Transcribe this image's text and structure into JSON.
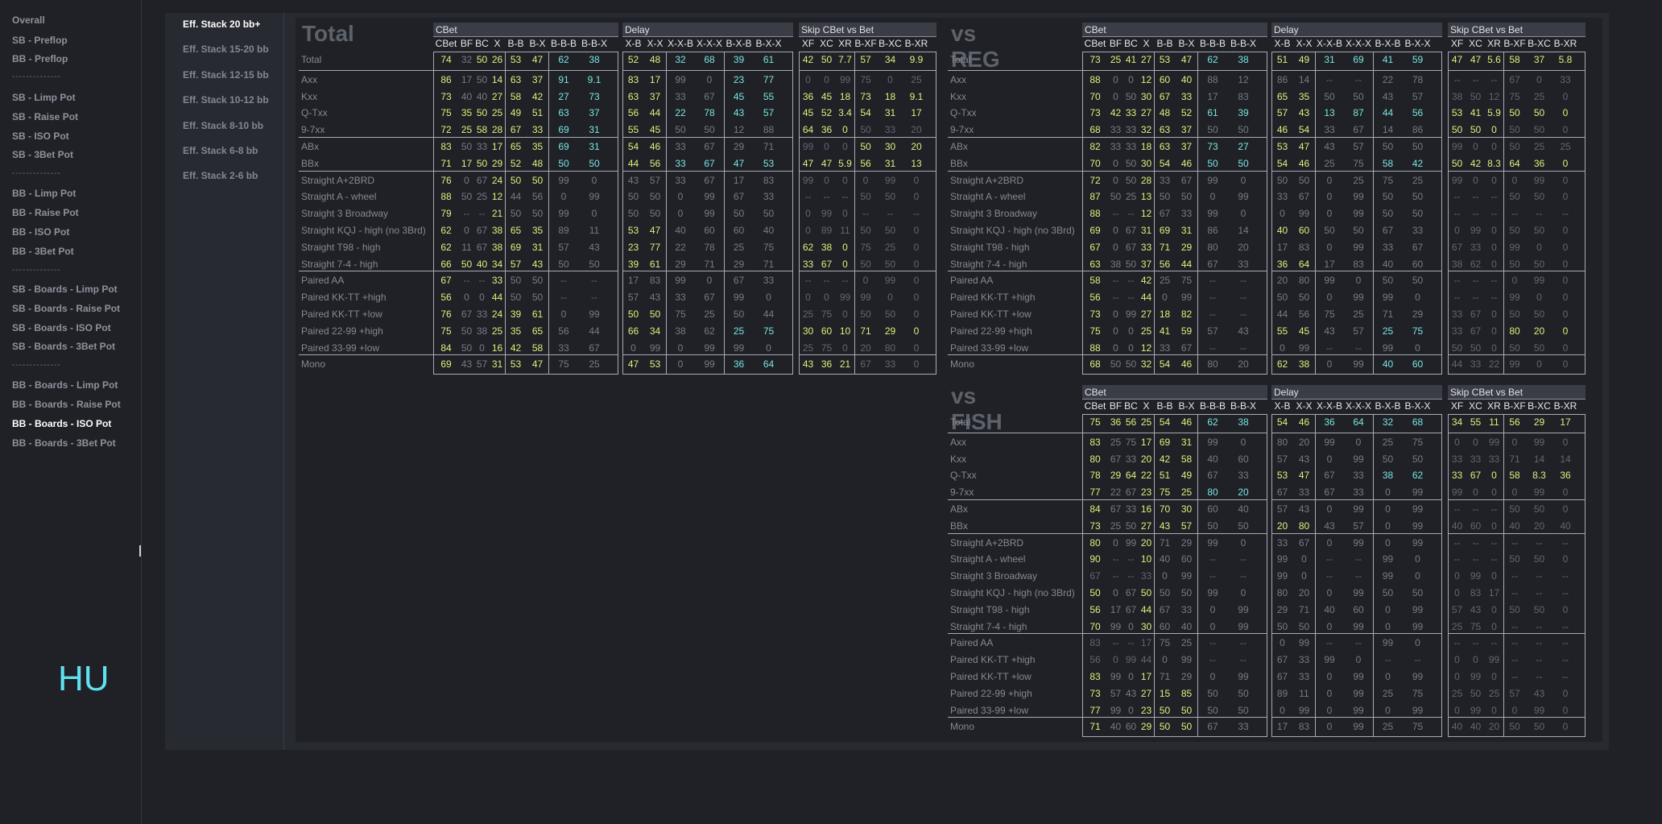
{
  "nav": {
    "items": [
      "Overall",
      "SB - Preflop",
      "BB - Preflop",
      "--------------",
      "SB - Limp Pot",
      "SB - Raise Pot",
      "SB - ISO Pot",
      "SB - 3Bet Pot",
      "--------------",
      "BB - Limp Pot",
      "BB - Raise Pot",
      "BB - ISO Pot",
      "BB - 3Bet Pot",
      "--------------",
      "SB - Boards - Limp Pot",
      "SB - Boards - Raise Pot",
      "SB - Boards - ISO Pot",
      "SB - Boards - 3Bet Pot",
      "--------------",
      "BB - Boards - Limp Pot",
      "BB - Boards - Raise Pot",
      "BB - Boards - ISO Pot",
      "BB - Boards - 3Bet Pot"
    ],
    "active": "BB - Boards - ISO Pot",
    "hu": "HU"
  },
  "stacks": {
    "items": [
      "Eff. Stack 20 bb+",
      "Eff. Stack 15-20 bb",
      "Eff. Stack 12-15 bb",
      "Eff. Stack 10-12 bb",
      "Eff. Stack 8-10 bb",
      "Eff. Stack 6-8 bb",
      "Eff. Stack 2-6 bb"
    ],
    "active": "Eff. Stack 20 bb+"
  },
  "groups": [
    "CBet",
    "Delay",
    "Skip CBet vs Bet"
  ],
  "subheaders": [
    [
      "CBet",
      "BF",
      "BC",
      "X",
      "B-B",
      "B-X",
      "B-B-B",
      "B-B-X"
    ],
    [
      "X-B",
      "X-X",
      "X-X-B",
      "X-X-X",
      "B-X-B",
      "B-X-X"
    ],
    [
      "XF",
      "XC",
      "XR",
      "B-XF",
      "B-XC",
      "B-XR"
    ]
  ],
  "row_labels": [
    "Total",
    "Axx",
    "Kxx",
    "Q-Txx",
    "9-7xx",
    "ABx",
    "BBx",
    "Straight A+2BRD",
    "Straight A - wheel",
    "Straight 3 Broadway",
    "Straight KQJ - high (no 3Brd)",
    "Straight T98 - high",
    "Straight 7-4 - high",
    "Paired AA",
    "Paired KK-TT +high",
    "Paired KK-TT +low",
    "Paired 22-99 +high",
    "Paired 33-99 +low",
    "Mono"
  ],
  "row_labels_fish": [
    "Total",
    "Axx",
    "Kxx",
    "Q-Txx",
    "9-7xx",
    "ABx",
    "BBx",
    "Straight A+2BRD",
    "Straight A - wheel",
    "Straight 3 Broadway",
    "Straight KQJ - high (no 3Brd)",
    "Straight T98 - high",
    "Straight 7-4 - high",
    "Paired AA",
    "Paired KK-TT +high",
    "Paired KK-TT +low",
    "Paired 22-99 +high",
    "Paired 33-99 +low",
    "Mono"
  ],
  "tables": {
    "total": {
      "title": "Total",
      "rows": [
        "74y 32g 50y 26y|53y 47y|62c 38c|52y 48y|32c 68c|39c 61c|42y 50y 7.7y|57y 34y 9.9y",
        "86y 17g 50g 14y|63y 37y|91c 9.1c|83y 17y|99g 0g|23c 77c|0e 0e 99e|75e 0e 25e",
        "73y 40g 40g 27y|58y 42y|27c 73c|63y 37y|33g 67g|45c 55c|36y 45y 18y|73y 18y 9.1y",
        "75y 35y 50y 25y|49y 51y|63c 37c|56y 44y|22c 78c|43c 57c|45y 52y 3.4y|54y 31y 17y",
        "72y 25y 58y 28y|67y 33y|69c 31c|55y 45y|50g 50g|12g 88g|64y 36y 0y|50e 33e 20e",
        "83y 50g 33g 17y|65y 35y|69c 31c|54y 46y|33g 67g|29g 71g|99e 0e 0e|50y 30y 20y",
        "71y 17y 50y 29y|52y 48y|50c 50c|44y 56y|33c 67c|47c 53c|47y 47y 5.9y|56y 31y 13y",
        "76y 0g 67g 24y|50y 50y|99g 0g|43g 57g|33g 67g|17g 83g|99e 0e 0e|0e 99e 0e",
        "88y 50g 25g 12y|44g 56g|0g 99g|50g 50g|0g 99g|67g 33g|--e --e --e|50e 50e 0e",
        "79y --e --e 21y|50g 50g|99g 0g|50g 50g|0g 99g|50g 50g|0e 99e 0e|--e --e --e",
        "62y 0g 67g 38y|65y 35y|89g 11g|53y 47y|40g 60g|60g 40g|0e 89e 11e|50e 50e 0e",
        "62y 11g 67g 38y|69y 31y|57g 43g|23y 77y|22g 78g|25g 75g|62y 38y 0y|75e 25e 0e",
        "66y 50y 40y 34y|57y 43y|50g 50g|39y 61y|29g 71g|29g 71g|33y 67y 0y|50e 50e 0e",
        "67y --e --e 33y|50g 50g|--e --e|17g 83g|99g 0g|67g 33g|--e --e --e|0e 99e 0e",
        "56y 0g 0g 44y|50g 50g|--e --e|57g 43g|33g 67g|99g 0g|0e 0e 99e|99e 0e 0e",
        "76y 67g 33g 24y|39y 61y|0g 99g|50y 50y|75g 25g|50g 44g|25e 75e 0e|50e 50e 0e",
        "75y 50g 38g 25y|35y 65y|56g 44g|66y 34y|38g 62g|25c 75c|30y 60y 10y|71y 29y 0y",
        "84y 50g 0g 16y|42y 58y|33g 67g|0g 99g|0g 99g|99g 0g|25e 75e 0e|20e 80e 0e",
        "69y 43g 57g 31y|53y 47y|75g 25g|47y 53y|0g 99g|36c 64c|43y 36y 21y|67e 33e 0e"
      ]
    },
    "reg": {
      "title": "vs REG",
      "rows": [
        "73y 25y 41y 27y|53y 47y|62c 38c|51y 49y|31c 69c|41c 59c|47y 47y 5.6y|58y 37y 5.8y",
        "88y 0g 0g 12y|60y 40y|88g 12g|86g 14g|--e --e|22g 78g|--e --e --e|67e 0e 33e",
        "70y 0g 50g 30y|67y 33y|17g 83g|65y 35y|50g 50g|43g 57g|38e 50e 12e|75e 25e 0e",
        "73y 42y 33y 27y|48y 52y|61c 39c|57y 43y|13c 87c|44c 56c|53y 41y 5.9y|50y 50y 0y",
        "68y 33g 33g 32y|63y 37y|50g 50g|46y 54y|33g 67g|14g 86g|50y 50y 0y|50e 50e 0e",
        "82y 33g 33g 18y|63y 37y|73c 27c|53y 47y|43g 57g|50g 50g|99e 0e 0e|50e 25e 25e",
        "70y 0g 50g 30y|54y 46y|50c 50c|54y 46y|25g 75g|58c 42c|50y 42y 8.3y|64y 36y 0y",
        "72y 0g 50g 28y|33g 67g|99g 0g|50g 50g|0g 25g|75g 25g|99e 0e 0e|0e 99e 0e",
        "87y 50g 25g 13y|50g 50g|0g 99g|33g 67g|0g 99g|50g 50g|--e --e --e|50e 50e 0e",
        "88y --e --e 12y|67g 33g|99g 0g|0g 99g|0g 99g|50g 50g|--e --e --e|--e --e --e",
        "69y 0g 67g 31y|69y 31y|86g 14g|40y 60y|50g 50g|67g 33g|0e 99e 0e|50e 50e 0e",
        "67y 0g 67g 33y|71y 29y|80g 20g|17g 83g|0g 99g|33g 67g|67e 33e 0e|99e 0e 0e",
        "63y 38g 50g 37y|56y 44y|67g 33g|36y 64y|17g 83g|40g 60g|38e 62e 0e|50e 50e 0e",
        "58y --e --e 42y|25g 75g|--e --e|20g 80g|99g 0g|50g 50g|--e --e --e|0e 99e 0e",
        "56y --e --e 44y|0g 99g|--e --e|50g 50g|0g 99g|99g 0g|--e --e --e|99e 0e 0e",
        "73y 0g 99g 27y|18y 82y|--e --e|44g 56g|75g 25g|71g 29g|33e 67e 0e|50e 50e 0e",
        "75y 0g 0g 25y|41y 59y|57g 43g|55y 45y|43g 57g|25c 75c|33e 67e 0e|80y 20y 0y",
        "88y 0g 0g 12y|33g 67g|--e --e|0g 99g|--e --e|99g 0g|50e 50e 0e|50e 50e 0e",
        "68y 50g 50g 32y|54y 46y|80g 20g|62y 38y|0g 99g|40c 60c|44e 33e 22e|99e 0e 0e"
      ]
    },
    "fish": {
      "title": "vs FISH",
      "rows": [
        "75y 36y 56y 25y|54y 46y|62c 38c|54y 46y|36c 64c|32c 68c|34y 55y 11y|56y 29y 17y",
        "83y 25g 75g 17y|69y 31y|99g 0g|80g 20g|99g 0g|25g 75g|0e 0e 99e|0e 99e 0e",
        "80y 67g 33g 20y|42y 58y|40g 60g|57g 43g|0g 99g|50g 50g|33e 33e 33e|71e 14e 14e",
        "78y 29y 64y 22y|51y 49y|67g 33g|53y 47y|67g 33g|38c 62c|33y 67y 0y|58y 8.3y 36y",
        "77y 22g 67g 23y|75y 25y|80c 20c|67g 33g|67g 33g|0g 99g|99e 0e 0e|0e 99e 0e",
        "84y 67g 33g 16y|70y 30y|60g 40g|57g 43g|0g 99g|0g 99g|--e --e --e|50e 50e 0e",
        "73y 25g 50g 27y|43y 57y|50g 50g|20y 80y|43g 57g|0g 99g|40e 60e 0e|40e 20e 40e",
        "80y 0g 99g 20y|71g 29g|99g 0g|33g 67g|0g 99g|0g 99g|--e --e --e|--e --e --e",
        "90y --e --e 10y|40g 60g|--e --e|99g 0g|--e --e|99g 0g|--e --e --e|50e 50e 0e",
        "67e --e --e 33e|0g 99g|--e --e|99g 0g|--e --e|99g 0g|0e 99e 0e|--e --e --e",
        "50y 0g 67g 50y|50g 50g|99g 0g|80g 20g|0g 99g|50g 50g|0e 83e 17e|--e --e --e",
        "56y 17g 67g 44y|67g 33g|0g 99g|29g 71g|40g 60g|0g 99g|57e 43e 0e|50e 50e 0e",
        "70y 99g 0g 30y|60g 40g|0g 99g|50g 50g|0g 99g|0g 99g|25e 75e 0e|--e --e --e",
        "83e --e --e 17e|75g 25g|--e --e|0g 99g|--e --e|99g 0g|--e --e --e|--e --e --e",
        "56e 0e 99e 44e|0g 99g|--e --e|67g 33g|99g 0g|--e --e|0e 0e 99e|--e --e --e",
        "83y 99g 0g 17y|71g 29g|0g 99g|67g 33g|0g 99g|0g 99g|0e 99e 0e|--e --e --e",
        "73y 57g 43g 27y|15y 85y|50g 50g|89g 11g|0g 99g|25g 75g|25e 50e 25e|57e 43e 0e",
        "77y 99g 0g 23y|50y 50y|50g 50g|0g 99g|0g 99g|0g 99g|0e 99e 0e|0e 99e 0e",
        "71y 40g 60g 29y|50y 50y|67g 33g|17g 83g|0g 99g|25g 75g|40e 40e 20e|50e 50e 0e"
      ]
    }
  }
}
